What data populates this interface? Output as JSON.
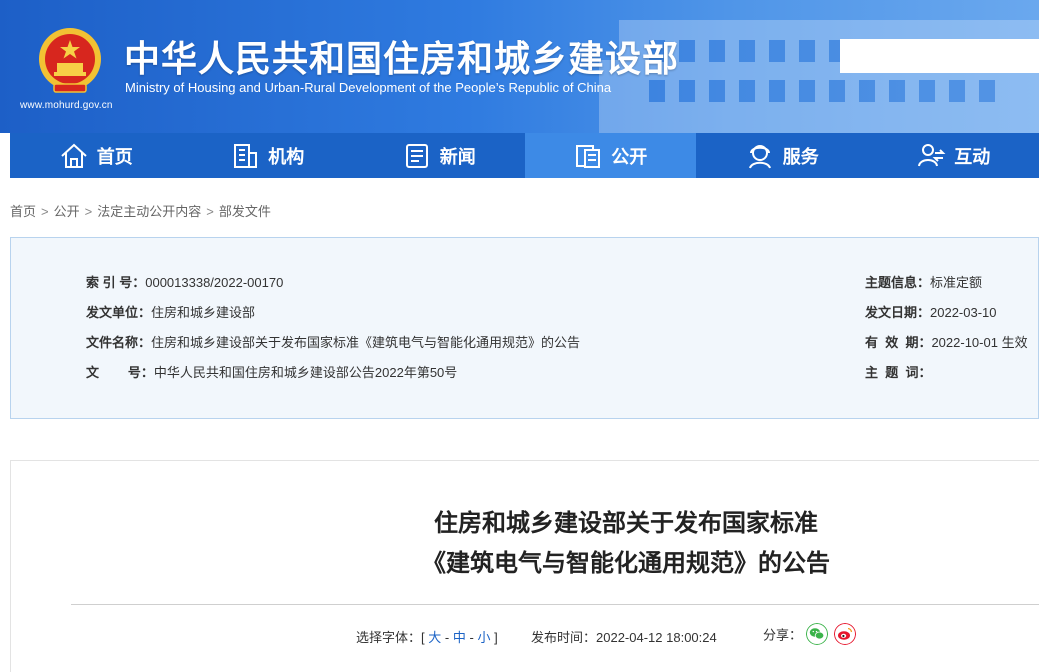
{
  "header": {
    "site_title_cn": "中华人民共和国住房和城乡建设部",
    "site_title_en": "Ministry of Housing and Urban-Rural Development of the People’s Republic of China",
    "site_url": "www.mohurd.gov.cn",
    "search_placeholder": ""
  },
  "nav": {
    "items": [
      {
        "label": "首页",
        "icon": "home-icon"
      },
      {
        "label": "机构",
        "icon": "building-icon"
      },
      {
        "label": "新闻",
        "icon": "news-icon"
      },
      {
        "label": "公开",
        "icon": "disclosure-icon",
        "active": true
      },
      {
        "label": "服务",
        "icon": "service-icon"
      },
      {
        "label": "互动",
        "icon": "interaction-icon"
      }
    ]
  },
  "breadcrumb": {
    "items": [
      "首页",
      "公开",
      "法定主动公开内容",
      "部发文件"
    ],
    "separator": ">"
  },
  "info": {
    "index_label": "索  引  号：",
    "index_value": "000013338/2022-00170",
    "issuer_label": "发文单位：",
    "issuer_value": "住房和城乡建设部",
    "filename_label": "文件名称：",
    "filename_value": "住房和城乡建设部关于发布国家标准《建筑电气与智能化通用规范》的公告",
    "docno_label": "文        号：",
    "docno_value": "中华人民共和国住房和城乡建设部公告2022年第50号",
    "topic_label": "主题信息：",
    "topic_value": "标准定额",
    "date_label": "发文日期：",
    "date_value": "2022-03-10",
    "valid_label": "有  效  期：",
    "valid_value": "2022-10-01 生效",
    "keywords_label": "主  题  词：",
    "keywords_value": ""
  },
  "article": {
    "title_line1": "住房和城乡建设部关于发布国家标准",
    "title_line2": "《建筑电气与智能化通用规范》的公告",
    "font_select_label": "选择字体：",
    "font_open": "[",
    "font_large": "大",
    "font_medium": "中",
    "font_small": "小",
    "font_close": "]",
    "font_dash": "-",
    "publish_label": "发布时间：",
    "publish_time": "2022-04-12 18:00:24",
    "share_label": "分享："
  },
  "colors": {
    "nav_bg": "#1b63c6",
    "nav_active": "#3d8ae6",
    "wechat": "#3bb34a",
    "weibo": "#e6162d"
  }
}
